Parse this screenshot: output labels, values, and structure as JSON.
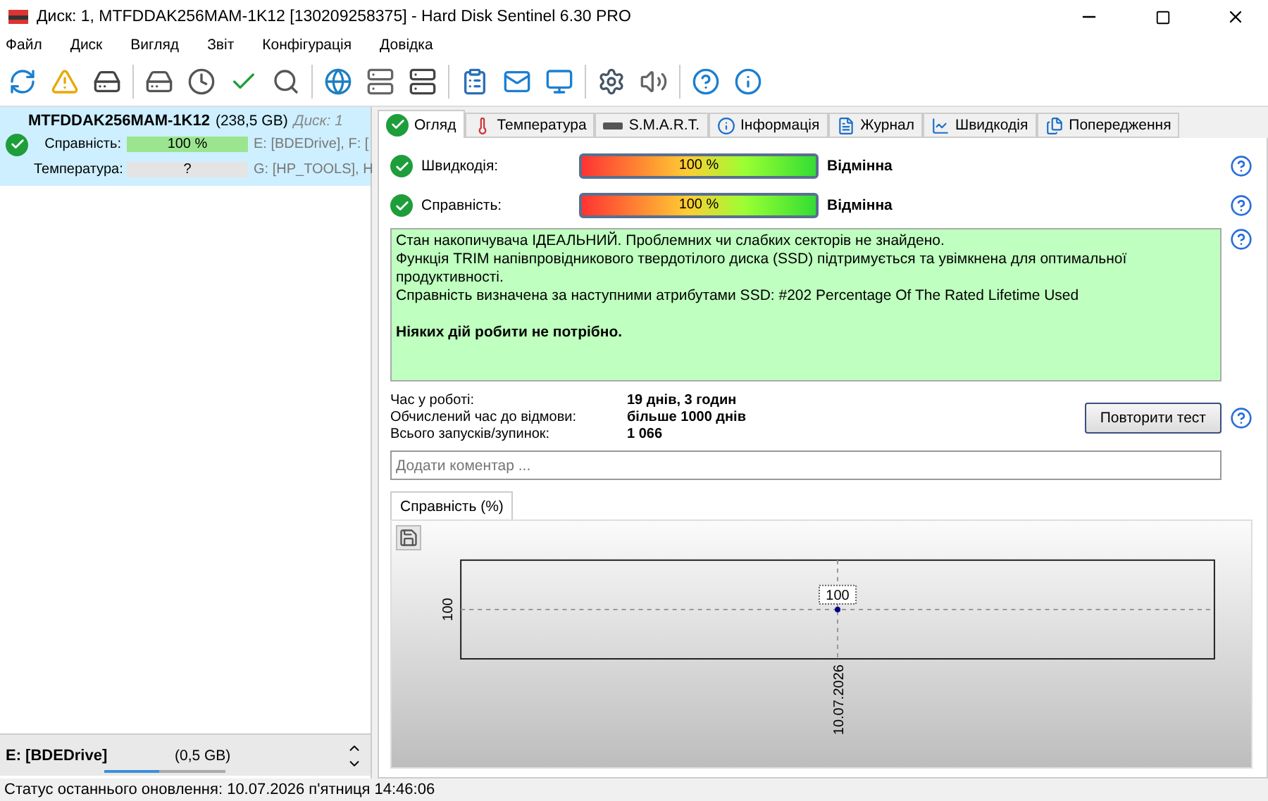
{
  "window": {
    "title": "Диск: 1, MTFDDAK256MAM-1K12 [130209258375]  -  Hard Disk Sentinel 6.30 PRO"
  },
  "menu": [
    {
      "label": "Файл"
    },
    {
      "label": "Диск"
    },
    {
      "label": "Вигляд"
    },
    {
      "label": "Звіт"
    },
    {
      "label": "Конфігурація"
    },
    {
      "label": "Довідка"
    }
  ],
  "disk": {
    "name": "MTFDDAK256MAM-1K12",
    "size": "(238,5 GB)",
    "index": "Диск: 1",
    "selected": true,
    "rows": [
      {
        "label": "Справність:",
        "reading": "100 %",
        "level": 1,
        "volumes": "E: [BDEDrive], F: [",
        "ok": true
      },
      {
        "label": "Температура:",
        "reading": "?",
        "level": 0,
        "volumes": "G: [HP_TOOLS], H",
        "ok": false
      }
    ]
  },
  "partition": {
    "name": "E: [BDEDrive]",
    "size": "(0,5 GB)",
    "level": 0.45
  },
  "tabs": [
    {
      "label": "Огляд",
      "selected": true
    },
    {
      "label": "Температура",
      "selected": false
    },
    {
      "label": "S.M.A.R.T.",
      "selected": false
    },
    {
      "label": "Інформація",
      "selected": false
    },
    {
      "label": "Журнал",
      "selected": false
    },
    {
      "label": "Швидкодія",
      "selected": false
    },
    {
      "label": "Попередження",
      "selected": false
    }
  ],
  "meters": [
    {
      "label": "Швидкодія:",
      "reading": "100 %",
      "level": 1,
      "rating": "Відмінна"
    },
    {
      "label": "Справність:",
      "reading": "100 %",
      "level": 1,
      "rating": "Відмінна"
    }
  ],
  "status_text": [
    "Стан накопичувача ІДЕАЛЬНИЙ. Проблемних чи слабких секторів не знайдено.",
    "Функція TRIM напівпровідникового твердотілого диска (SSD) підтримується та увімкнена для оптимальної продуктивності.",
    "Справність визначена за наступними атрибутами SSD:  #202 Percentage Of The Rated Lifetime Used"
  ],
  "recommendation": "Ніяких дій робити не потрібно.",
  "stats": [
    {
      "label": "Час у роботі:",
      "value": "19 днів, 3 годин"
    },
    {
      "label": "Обчислений час до відмови:",
      "value": "більше 1000 днів"
    },
    {
      "label": "Всього запусків/зупинок:",
      "value": "1 066"
    }
  ],
  "retest_button": "Повторити тест",
  "comment": {
    "placeholder": "Додати коментар ..."
  },
  "chart_tab": {
    "label": "Справність (%)",
    "selected": true
  },
  "chart": {
    "y_label": "100",
    "x_label": "10.07.2026",
    "point_label": "100"
  },
  "status_bar": "Статус останнього оновлення: 10.07.2026 п'ятниця 14:46:06"
}
